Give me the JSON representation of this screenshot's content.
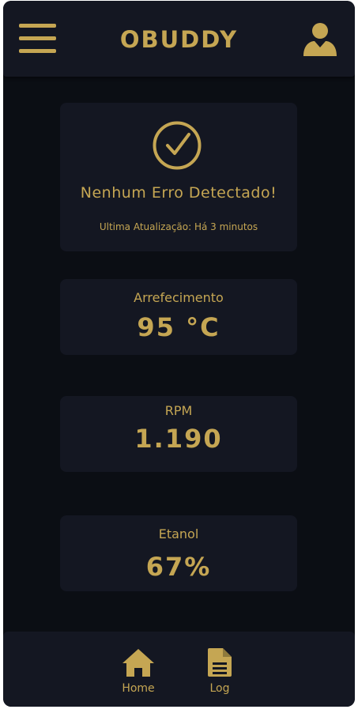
{
  "header": {
    "title": "OBUDDY",
    "menu_icon": "hamburger-menu-icon",
    "profile_icon": "user-profile-icon"
  },
  "status": {
    "icon": "check-circle-icon",
    "title": "Nenhum Erro Detectado!",
    "last_update": "Ultima Atualização: Há 3 minutos"
  },
  "metrics": [
    {
      "label": "Arrefecimento",
      "value": "95 °C"
    },
    {
      "label": "RPM",
      "value": "1.190"
    },
    {
      "label": "Etanol",
      "value": "67%"
    }
  ],
  "nav": {
    "items": [
      {
        "label": "Home",
        "icon": "home-icon"
      },
      {
        "label": "Log",
        "icon": "document-icon"
      }
    ]
  },
  "colors": {
    "accent": "#c5a653",
    "background": "#0b0e14",
    "card": "#141722"
  }
}
